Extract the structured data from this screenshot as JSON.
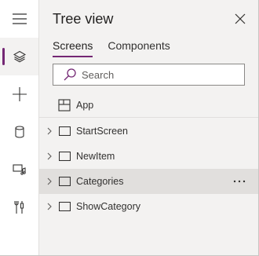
{
  "panel": {
    "title": "Tree view",
    "tabs": [
      {
        "label": "Screens",
        "active": true
      },
      {
        "label": "Components",
        "active": false
      }
    ],
    "search": {
      "placeholder": "Search",
      "value": ""
    },
    "app_item": {
      "label": "App",
      "icon": "app-icon"
    },
    "screens": [
      {
        "label": "StartScreen",
        "hover": false
      },
      {
        "label": "NewItem",
        "hover": false
      },
      {
        "label": "Categories",
        "hover": true
      },
      {
        "label": "ShowCategory",
        "hover": false
      }
    ]
  },
  "rail": {
    "items": [
      {
        "icon": "hamburger-menu-icon",
        "active": false
      },
      {
        "icon": "layers-icon",
        "active": true
      },
      {
        "icon": "plus-icon",
        "active": false
      },
      {
        "icon": "database-icon",
        "active": false
      },
      {
        "icon": "media-icon",
        "active": false
      },
      {
        "icon": "tools-icon",
        "active": false
      }
    ]
  },
  "colors": {
    "accent": "#742774",
    "panel_bg": "#f3f2f1",
    "hover_row": "#e1dfdd"
  }
}
